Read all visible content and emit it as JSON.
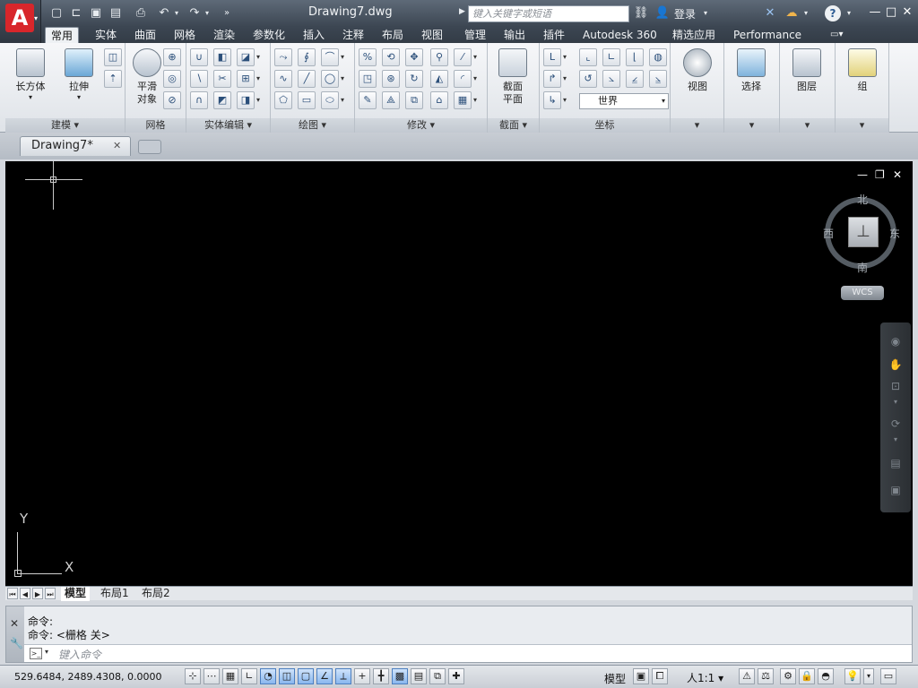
{
  "title_bar": {
    "app_logo": "A",
    "document_title": "Drawing7.dwg",
    "search_placeholder": "键入关键字或短语",
    "login_label": "登录",
    "quick_access": [
      "new-icon",
      "open-icon",
      "save-icon",
      "save-as-icon",
      "print-icon",
      "undo-icon",
      "redo-icon"
    ],
    "window_controls": [
      "—",
      "□",
      "✕"
    ]
  },
  "ribbon_tabs": [
    "常用",
    "实体",
    "曲面",
    "网格",
    "渲染",
    "参数化",
    "插入",
    "注释",
    "布局",
    "视图",
    "管理",
    "输出",
    "插件",
    "Autodesk 360",
    "精选应用",
    "Performance"
  ],
  "active_tab": "常用",
  "ribbon": {
    "panels": {
      "modeling": {
        "title": "建模 ▾",
        "box_label": "长方体",
        "extrude_label": "拉伸"
      },
      "mesh": {
        "title": "网格",
        "smooth_label_1": "平滑",
        "smooth_label_2": "对象"
      },
      "solid_edit": {
        "title": "实体编辑 ▾"
      },
      "draw": {
        "title": "绘图 ▾"
      },
      "modify": {
        "title": "修改 ▾"
      },
      "section": {
        "title": "截面 ▾",
        "plane_label_1": "截面",
        "plane_label_2": "平面"
      },
      "coordinates": {
        "title": "坐标",
        "ucs_value": "世界"
      },
      "view": {
        "label": "视图"
      },
      "selection": {
        "label": "选择"
      },
      "layers": {
        "label": "图层"
      },
      "groups": {
        "label": "组"
      }
    }
  },
  "doc_tabs": {
    "active": "Drawing7*",
    "close": "✕"
  },
  "viewport": {
    "controls": [
      "—",
      "❐",
      "✕"
    ],
    "compass": {
      "north": "北",
      "south": "南",
      "east": "东",
      "west": "西"
    },
    "wcs_label": "WCS",
    "ucs_x": "X",
    "ucs_y": "Y"
  },
  "layout_tabs": [
    "模型",
    "布局1",
    "布局2"
  ],
  "active_layout": "模型",
  "command_line": {
    "history": [
      "命令:",
      "命令:  <栅格 关>"
    ],
    "input_placeholder": "键入命令"
  },
  "status_bar": {
    "coordinates": "529.6484,   2489.4308,  0.0000",
    "model_label": "模型",
    "scale_label": "人1:1 ▾"
  }
}
